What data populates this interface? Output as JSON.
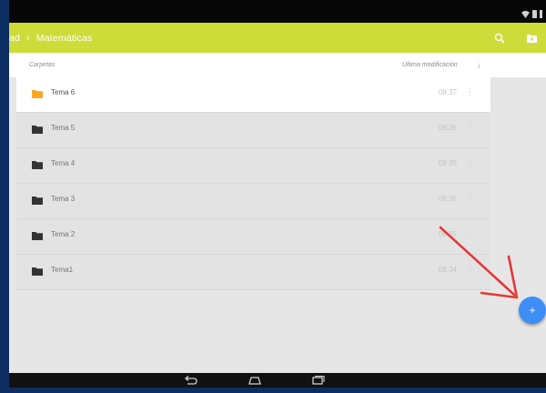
{
  "status_bar": {
    "icons": [
      "wifi-icon",
      "battery-icon"
    ]
  },
  "app_bar": {
    "breadcrumb_prefix": "ad",
    "breadcrumb_separator": "›",
    "breadcrumb_current": "Matemáticas",
    "actions": [
      "search-icon",
      "folder-add-icon"
    ],
    "color": "#cddc39"
  },
  "list_header": {
    "folders_label": "Carpetas",
    "modified_label": "Última modificación",
    "sort_icon": "↓"
  },
  "folders": [
    {
      "name": "Tema 6",
      "time": "08:37",
      "highlighted": true,
      "icon_color": "#f9a825"
    },
    {
      "name": "Tema 5",
      "time": "08:36",
      "highlighted": false,
      "icon_color": "#333333"
    },
    {
      "name": "Tema 4",
      "time": "08:35",
      "highlighted": false,
      "icon_color": "#333333"
    },
    {
      "name": "Tema 3",
      "time": "08:35",
      "highlighted": false,
      "icon_color": "#333333"
    },
    {
      "name": "Tema 2",
      "time": "08:35",
      "highlighted": false,
      "icon_color": "#333333"
    },
    {
      "name": "Tema1",
      "time": "08:34",
      "highlighted": false,
      "icon_color": "#333333"
    }
  ],
  "overflow_glyph": "⋮",
  "fab": {
    "label": "+",
    "color": "#3e8ef7"
  },
  "annotation": {
    "color": "#e53935"
  },
  "nav_bar": {
    "icons": [
      "back-icon",
      "home-icon",
      "recents-icon"
    ]
  }
}
